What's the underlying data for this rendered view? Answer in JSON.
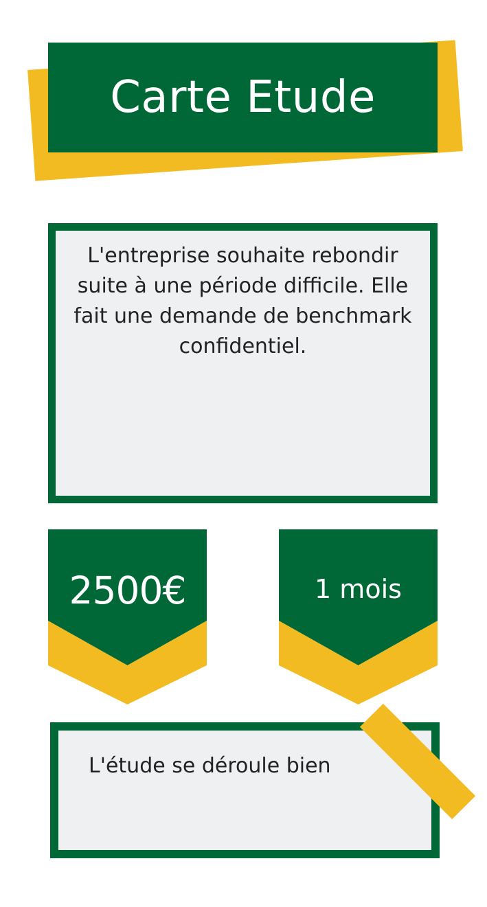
{
  "card": {
    "title": "Carte Etude",
    "description": "L'entreprise souhaite rebondir suite à une période difficile. Elle fait une demande de benchmark confidentiel.",
    "price": "2500€",
    "duration": "1 mois",
    "outcome": "L'étude se déroule bien"
  },
  "colors": {
    "primary_green": "#006837",
    "accent_yellow": "#F2BB22",
    "card_background": "#EFF0F2",
    "text_dark": "#222222"
  }
}
